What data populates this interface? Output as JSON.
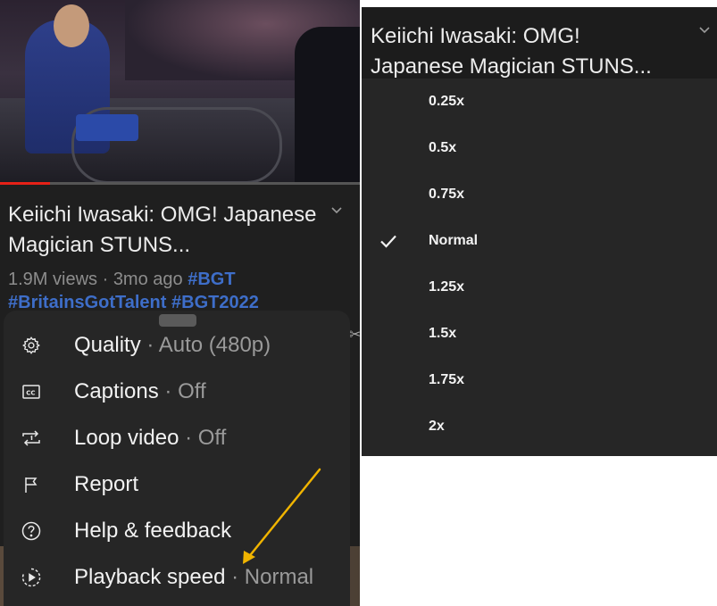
{
  "video": {
    "title": "Keiichi Iwasaki: OMG! Japanese Magician STUNS...",
    "views": "1.9M views",
    "separator": " · ",
    "age": "3mo ago",
    "hashtags": [
      "#BGT",
      "#BritainsGotTalent",
      "#BGT2022"
    ],
    "progress_fraction": 0.14
  },
  "menu": {
    "items": [
      {
        "icon": "gear-icon",
        "label": "Quality",
        "value": "Auto (480p)"
      },
      {
        "icon": "captions-icon",
        "label": "Captions",
        "value": "Off"
      },
      {
        "icon": "loop-icon",
        "label": "Loop video",
        "value": "Off"
      },
      {
        "icon": "flag-icon",
        "label": "Report",
        "value": ""
      },
      {
        "icon": "help-icon",
        "label": "Help & feedback",
        "value": ""
      },
      {
        "icon": "playback-speed-icon",
        "label": "Playback speed",
        "value": "Normal"
      }
    ],
    "value_separator": " · "
  },
  "speed_menu": {
    "options": [
      "0.25x",
      "0.5x",
      "0.75x",
      "Normal",
      "1.25x",
      "1.5x",
      "1.75x",
      "2x"
    ],
    "selected": "Normal"
  },
  "colors": {
    "annotation_arrow": "#f0b400",
    "progress": "#e62117",
    "hashtag": "#3e6ec9"
  }
}
